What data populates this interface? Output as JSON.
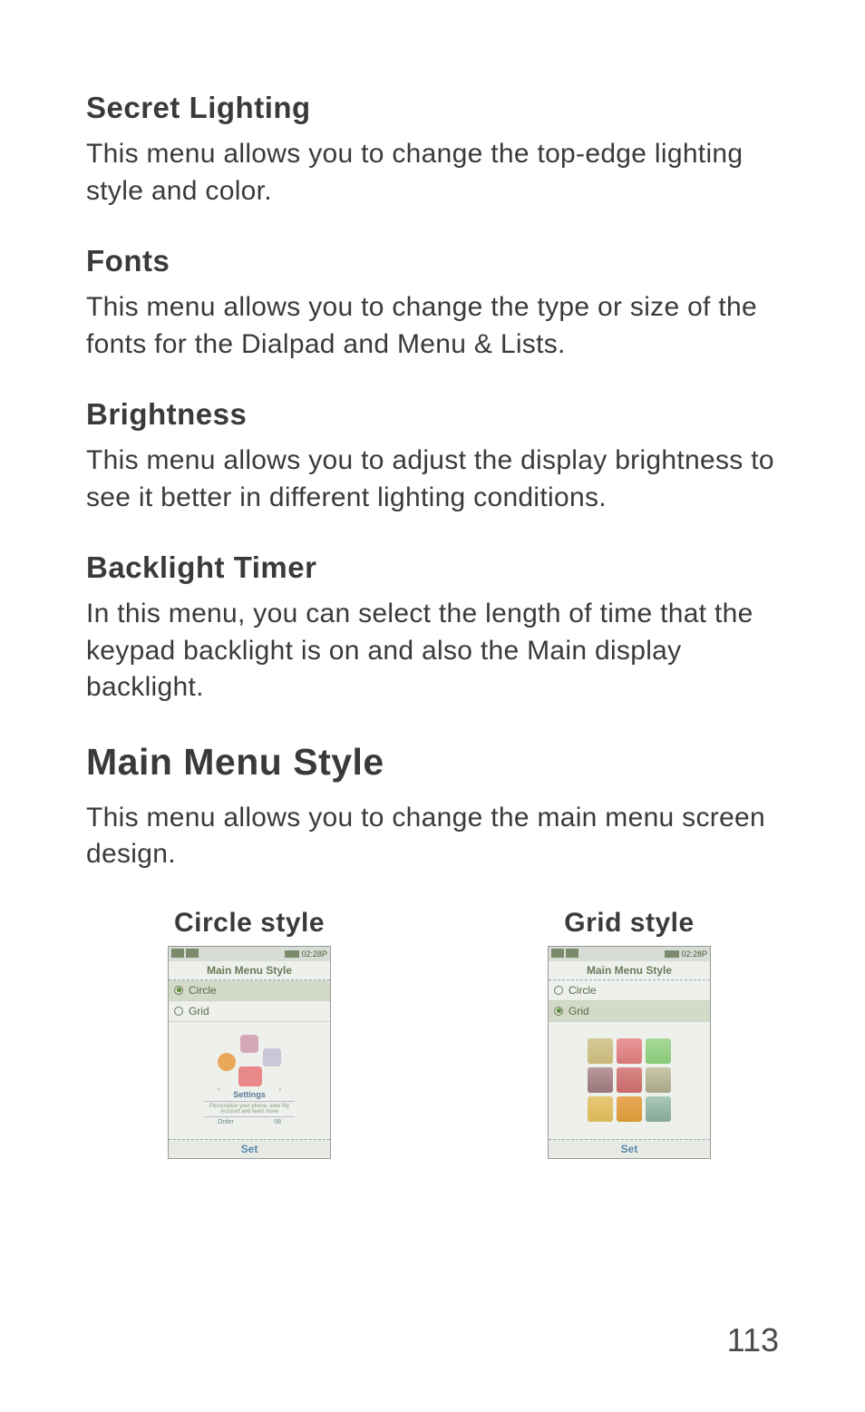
{
  "sections": {
    "secret_lighting": {
      "heading": "Secret Lighting",
      "body": "This menu allows you to change the top-edge lighting style and color."
    },
    "fonts": {
      "heading": "Fonts",
      "body": "This menu allows you to change the type or size of the fonts for the Dialpad and Menu & Lists."
    },
    "brightness": {
      "heading": "Brightness",
      "body": "This menu allows you to adjust the display brightness to see it better in different lighting conditions."
    },
    "backlight_timer": {
      "heading": "Backlight Timer",
      "body": "In this menu, you can select the length of time that the keypad backlight is on and also the Main display backlight."
    }
  },
  "main_menu_style": {
    "heading": "Main Menu Style",
    "body": "This menu allows you to change the main menu screen design.",
    "circle_label": "Circle style",
    "grid_label": "Grid style"
  },
  "phone": {
    "title": "Main Menu Style",
    "option_circle": "Circle",
    "option_grid": "Grid",
    "footer": "Set",
    "time": "02:28P",
    "circle_preview_label": "Settings",
    "circle_preview_sub": "Personalize your phone, view My Account and learn more",
    "nav_left": "Order",
    "nav_right": "08"
  },
  "page_number": "113"
}
